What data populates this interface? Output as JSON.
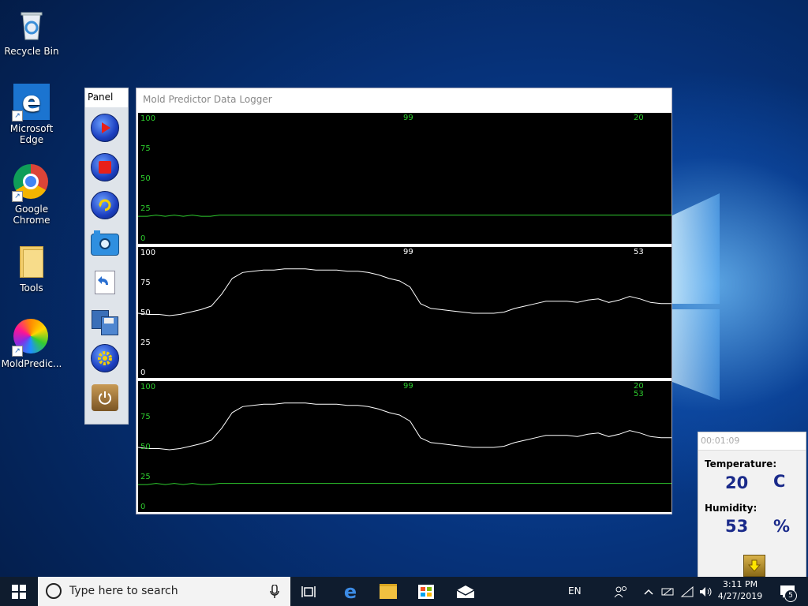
{
  "desktop": {
    "icons": [
      {
        "label": "Recycle Bin"
      },
      {
        "label": "Microsoft Edge"
      },
      {
        "label": "Google Chrome"
      },
      {
        "label": "Tools"
      },
      {
        "label": "MoldPredic..."
      }
    ]
  },
  "panel": {
    "title": "Panel",
    "buttons": [
      "play",
      "stop",
      "refresh",
      "camera",
      "import",
      "save",
      "settings",
      "power"
    ]
  },
  "main_window": {
    "title": "Mold Predictor Data Logger",
    "plots": [
      {
        "y_ticks": [
          "100",
          "75",
          "50",
          "25",
          "0"
        ],
        "tick_color": "#2ecc2e",
        "center_label": "99",
        "center_color": "#2ecc2e",
        "right_labels": [
          "20"
        ],
        "right_colors": [
          "#2ecc2e"
        ]
      },
      {
        "y_ticks": [
          "100",
          "75",
          "50",
          "25",
          "0"
        ],
        "tick_color": "#ffffff",
        "center_label": "99",
        "center_color": "#ffffff",
        "right_labels": [
          "53"
        ],
        "right_colors": [
          "#ffffff"
        ]
      },
      {
        "y_ticks": [
          "100",
          "75",
          "50",
          "25",
          "0"
        ],
        "tick_color": "#2ecc2e",
        "center_label": "99",
        "center_color": "#2ecc2e",
        "right_labels": [
          "20",
          "53"
        ],
        "right_colors": [
          "#2ecc2e",
          "#2ecc2e"
        ]
      }
    ]
  },
  "chart_data": {
    "type": "line",
    "ylim": [
      0,
      100
    ],
    "series": [
      {
        "color": "#2ecc2e",
        "values": [
          19,
          19,
          20,
          19,
          20,
          19,
          20,
          19,
          19,
          20,
          20,
          20,
          20,
          20,
          20,
          20,
          20,
          20,
          20,
          20,
          20,
          20,
          20,
          20,
          20,
          20,
          20,
          20,
          20,
          20,
          20,
          20,
          20,
          20,
          20,
          20,
          20,
          20,
          20,
          20,
          20,
          20,
          20,
          20,
          20,
          20,
          20,
          20,
          20,
          20,
          20,
          20,
          20,
          20,
          20,
          20,
          20,
          20,
          20,
          20
        ]
      },
      {
        "color": "#ffffff",
        "values": [
          50,
          49,
          49,
          48,
          49,
          51,
          53,
          56,
          66,
          79,
          84,
          85,
          86,
          86,
          87,
          87,
          87,
          86,
          86,
          86,
          85,
          85,
          84,
          82,
          79,
          77,
          72,
          58,
          54,
          53,
          52,
          51,
          50,
          50,
          50,
          51,
          54,
          56,
          58,
          60,
          60,
          60,
          59,
          61,
          62,
          59,
          61,
          64,
          62,
          59,
          58,
          58
        ]
      }
    ],
    "plots": [
      {
        "series_index": [
          0
        ]
      },
      {
        "series_index": [
          1
        ]
      },
      {
        "series_index": [
          0,
          1
        ]
      }
    ]
  },
  "mini_widget": {
    "timer": "00:01:09",
    "temperature_label": "Temperature:",
    "temperature_value": "20",
    "temperature_unit": "C",
    "humidity_label": "Humidity:",
    "humidity_value": "53",
    "humidity_unit": "%"
  },
  "taskbar": {
    "search_placeholder": "Type here to search",
    "language": "EN",
    "time": "3:11 PM",
    "date": "4/27/2019",
    "notification_count": "5"
  }
}
